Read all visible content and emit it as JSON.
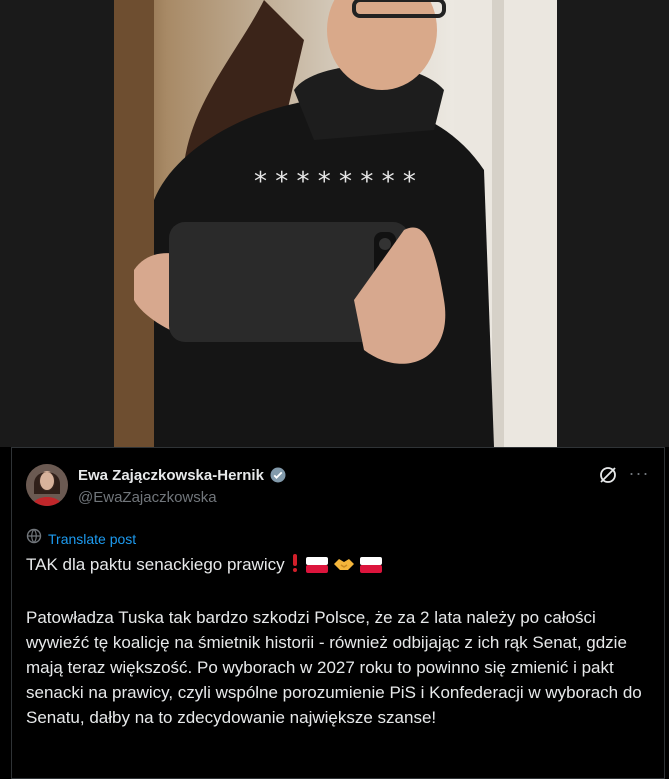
{
  "tweet": {
    "display_name": "Ewa Zajączkowska-Hernik",
    "handle": "@EwaZajaczkowska",
    "translate_label": "Translate post",
    "line1_text": "TAK dla paktu senackiego prawicy",
    "body": "Patowładza Tuska tak bardzo szkodzi Polsce, że za 2 lata należy po całości wywieźć tę koalicję na śmietnik historii - również odbijając z ich rąk Senat, gdzie mają teraz większość. Po wyborach w 2027 roku to powinno się zmienić i pakt senacki na prawicy, czyli wspólne porozumienie PiS i Konfederacji w wyborach do Senatu, dałby na to zdecydowanie największe szanse!"
  },
  "icons": {
    "verified": "verified-badge-icon",
    "grok": "grok-icon",
    "more": "more-icon",
    "translate": "globe-icon",
    "emoji": [
      "exclamation-icon",
      "poland-flag-icon",
      "handshake-icon",
      "poland-flag-icon"
    ]
  },
  "colors": {
    "accent": "#1d9bf0",
    "muted": "#71767b",
    "text": "#e7e9ea",
    "background": "#000000",
    "border": "#2f3336"
  }
}
